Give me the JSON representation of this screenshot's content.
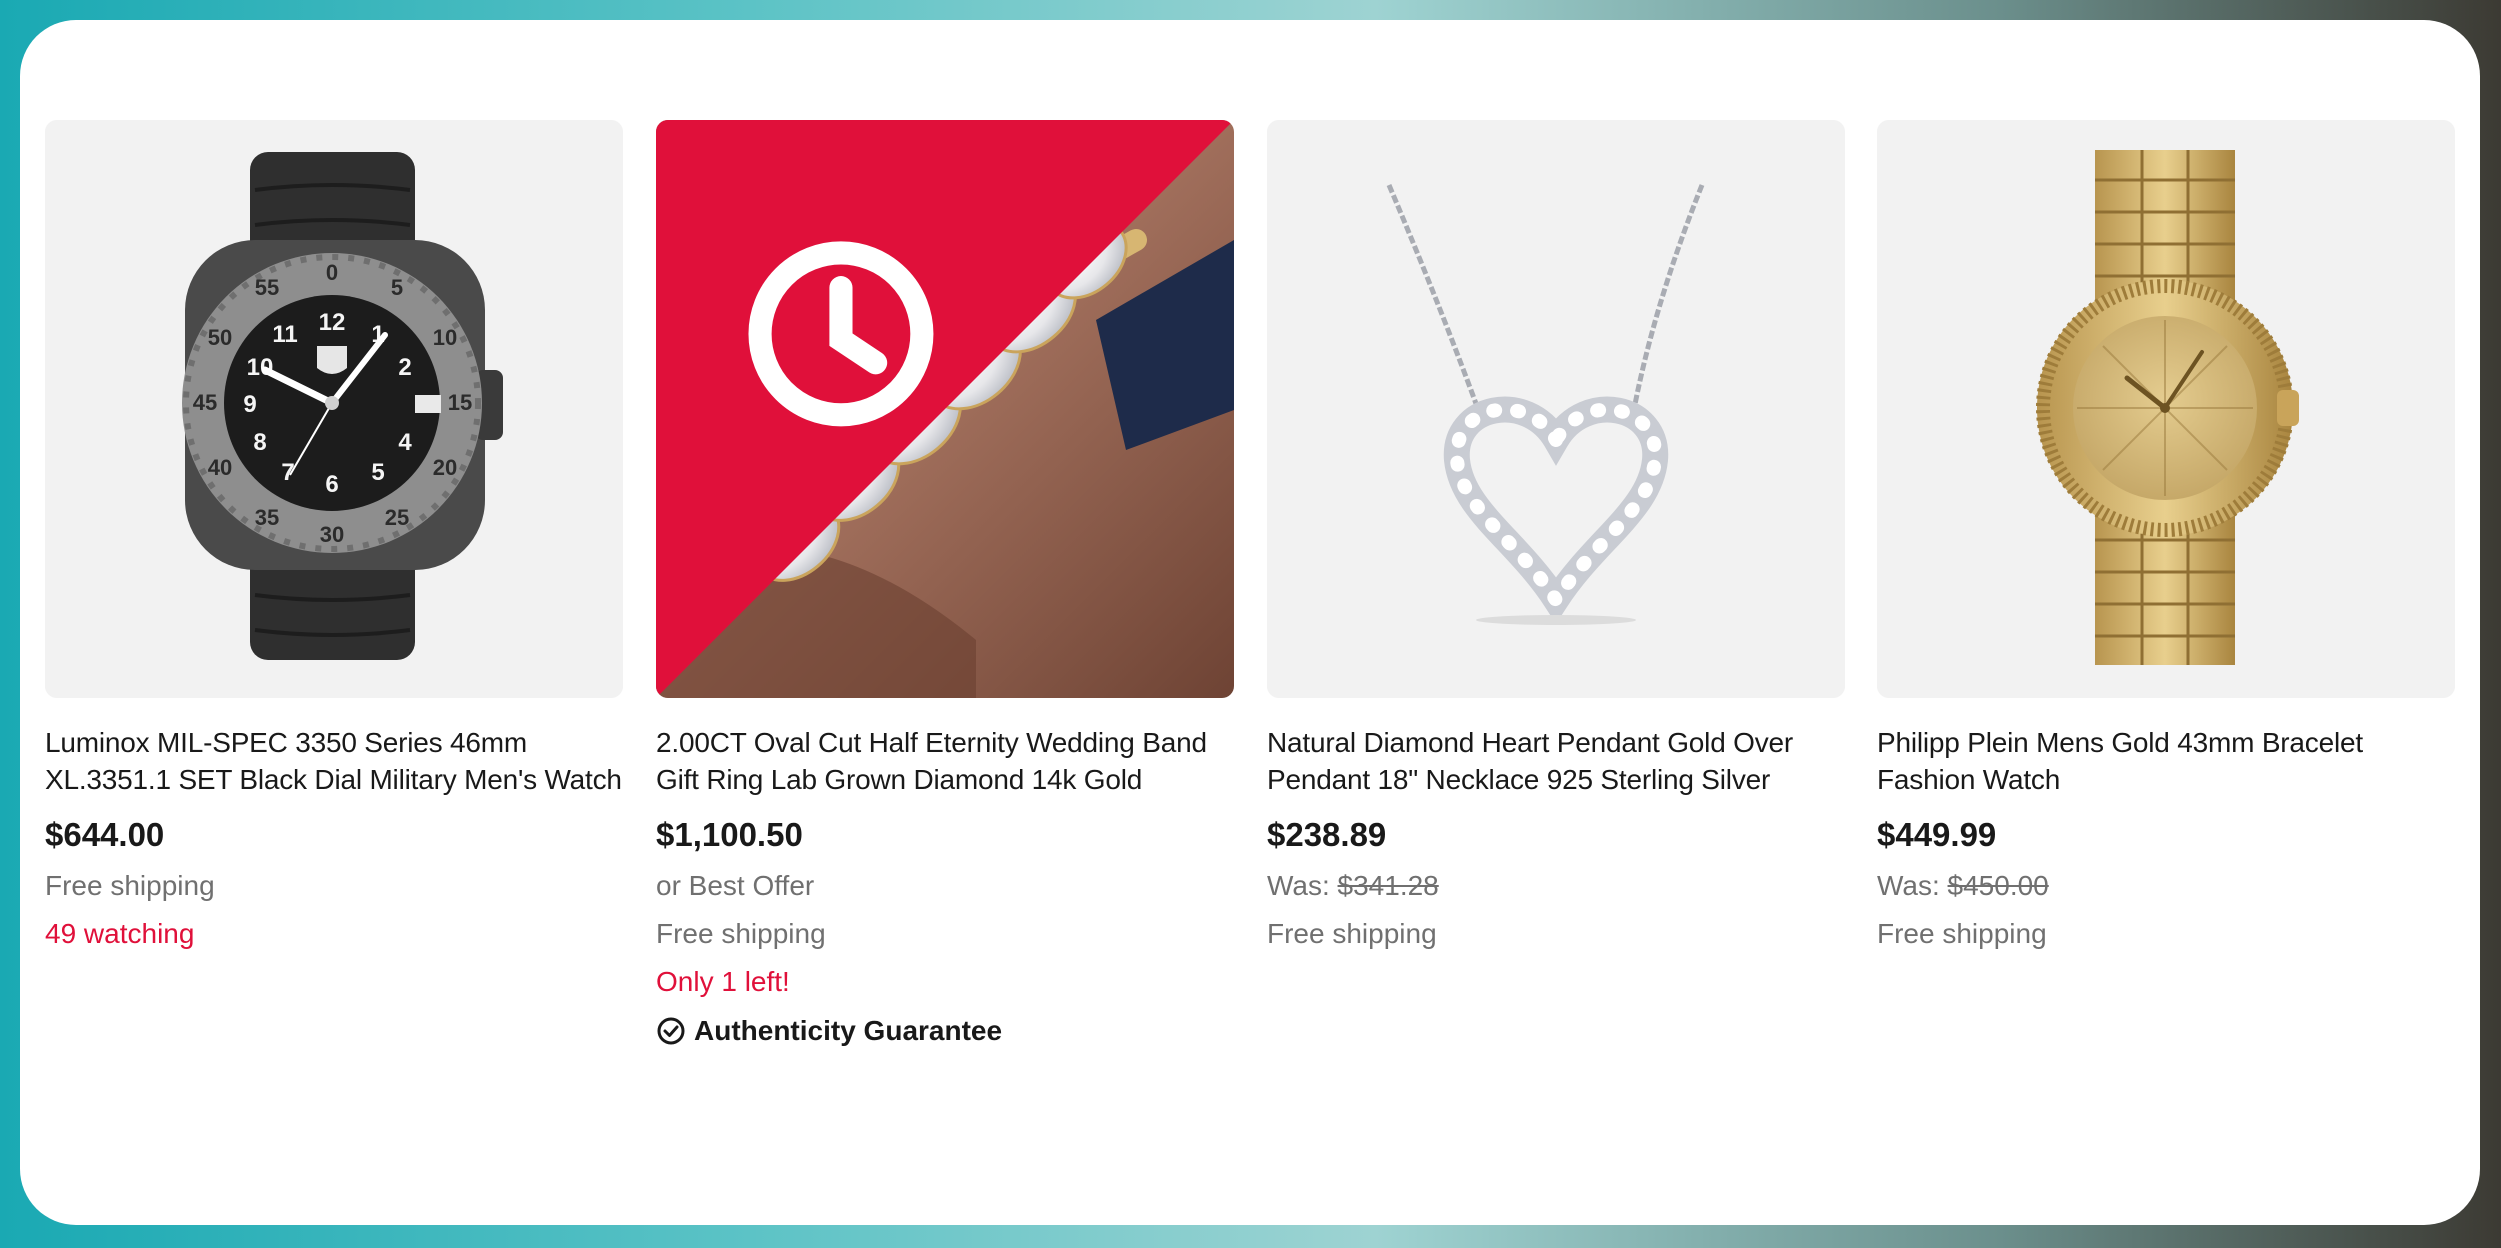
{
  "products": [
    {
      "title": "Luminox MIL-SPEC 3350 Series 46mm XL.3351.1 SET Black Dial Military Men's Watch",
      "price": "$644.00",
      "shipping": "Free shipping",
      "watching": "49 watching",
      "image_icon": "black-military-watch",
      "carousel_progress": 0.25
    },
    {
      "title": "2.00CT Oval Cut Half Eternity Wedding Band Gift Ring Lab Grown Diamond 14k Gold",
      "price": "$1,100.50",
      "offer": "or Best Offer",
      "shipping": "Free shipping",
      "stock_note": "Only 1 left!",
      "authenticity": "Authenticity Guarantee",
      "image_icon": "diamond-ring",
      "badge_icon": "clock-icon",
      "carousel_progress": 0.25
    },
    {
      "title": "Natural Diamond Heart Pendant Gold Over Pendant 18\" Necklace 925 Sterling Silver",
      "price": "$238.89",
      "was_label": "Was:",
      "was_price": "$341.28",
      "shipping": "Free shipping",
      "image_icon": "heart-necklace",
      "carousel_progress": 0.25
    },
    {
      "title": "Philipp Plein Mens Gold 43mm Bracelet Fashion Watch",
      "price": "$449.99",
      "was_label": "Was:",
      "was_price": "$450.00",
      "shipping": "Free shipping",
      "image_icon": "gold-bracelet-watch",
      "carousel_progress": 0.25
    }
  ],
  "colors": {
    "text": "#191919",
    "muted": "#707070",
    "urgent": "#e0103a",
    "badge": "#e0103a"
  }
}
